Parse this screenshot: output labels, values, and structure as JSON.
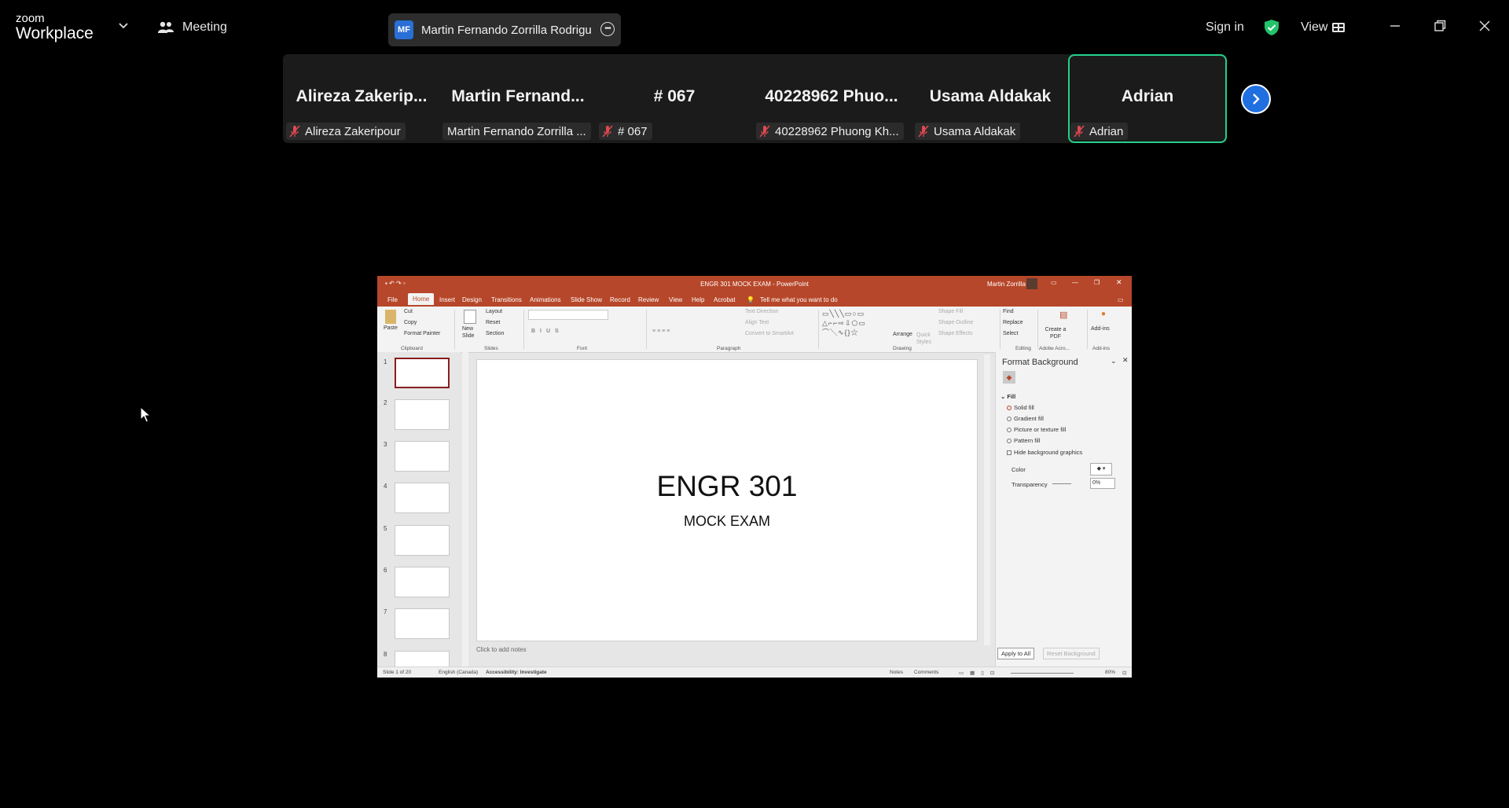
{
  "brand": {
    "line1": "zoom",
    "line2": "Workplace"
  },
  "meeting": {
    "label": "Meeting"
  },
  "active_speaker": {
    "initials": "MF",
    "name": "Martin Fernando Zorrilla Rodrigu"
  },
  "header": {
    "signin": "Sign in",
    "view": "View"
  },
  "colors": {
    "accent": "#23d18b",
    "zoom_blue": "#1f6fe0",
    "ppt_red": "#b7472a"
  },
  "participants": [
    {
      "display": "Alireza  Zakerip...",
      "label": "Alireza Zakeripour",
      "muted": true
    },
    {
      "display": "Martin  Fernand...",
      "label": "Martin Fernando Zorrilla ...",
      "muted": false
    },
    {
      "display": "# 067",
      "label": "# 067",
      "muted": true
    },
    {
      "display": "40228962  Phuo...",
      "label": "40228962 Phuong Kh...",
      "muted": true
    },
    {
      "display": "Usama Aldakak",
      "label": "Usama Aldakak",
      "muted": true
    },
    {
      "display": "Adrian",
      "label": "Adrian",
      "muted": true,
      "active": true
    }
  ],
  "ppt": {
    "title": "ENGR 301 MOCK EXAM  -  PowerPoint",
    "user": "Martin Zorrilla",
    "tabs": [
      "File",
      "Home",
      "Insert",
      "Design",
      "Transitions",
      "Animations",
      "Slide Show",
      "Record",
      "Review",
      "View",
      "Help",
      "Acrobat",
      "Tell me what you want to do"
    ],
    "ribbon": {
      "paste": "Paste",
      "cut": "Cut",
      "copy": "Copy",
      "format_painter": "Format Painter",
      "new_slide": "New Slide",
      "layout": "Layout",
      "reset": "Reset",
      "section": "Section",
      "text_direction": "Text Direction",
      "align_text": "Align Text",
      "convert_smartart": "Convert to SmartArt",
      "arrange": "Arrange",
      "quick_styles": "Quick Styles",
      "shape_fill": "Shape Fill",
      "shape_outline": "Shape Outline",
      "shape_effects": "Shape Effects",
      "find": "Find",
      "replace": "Replace",
      "select": "Select",
      "create_pdf": "Create a PDF",
      "add_ins": "Add-ins",
      "groups": [
        "Clipboard",
        "Slides",
        "Font",
        "Paragraph",
        "Drawing",
        "Editing",
        "Adobe Acro...",
        "Add-ins"
      ]
    },
    "slide_numbers": [
      "1",
      "2",
      "3",
      "4",
      "5",
      "6",
      "7",
      "8"
    ],
    "slide": {
      "title": "ENGR 301",
      "subtitle": "MOCK EXAM"
    },
    "notes_placeholder": "Click to add notes",
    "format_background": {
      "title": "Format Background",
      "section": "Fill",
      "options": [
        "Solid fill",
        "Gradient fill",
        "Picture or texture fill",
        "Pattern fill"
      ],
      "selected": "Solid fill",
      "hide_graphics": "Hide background graphics",
      "color_label": "Color",
      "transparency_label": "Transparency",
      "transparency_value": "0%",
      "apply_all": "Apply to All",
      "reset_bg": "Reset Background"
    },
    "status": {
      "slide": "Slide 1 of 20",
      "language": "English (Canada)",
      "accessibility": "Accessibility: Investigate",
      "notes": "Notes",
      "comments": "Comments",
      "zoom": "80%"
    }
  }
}
